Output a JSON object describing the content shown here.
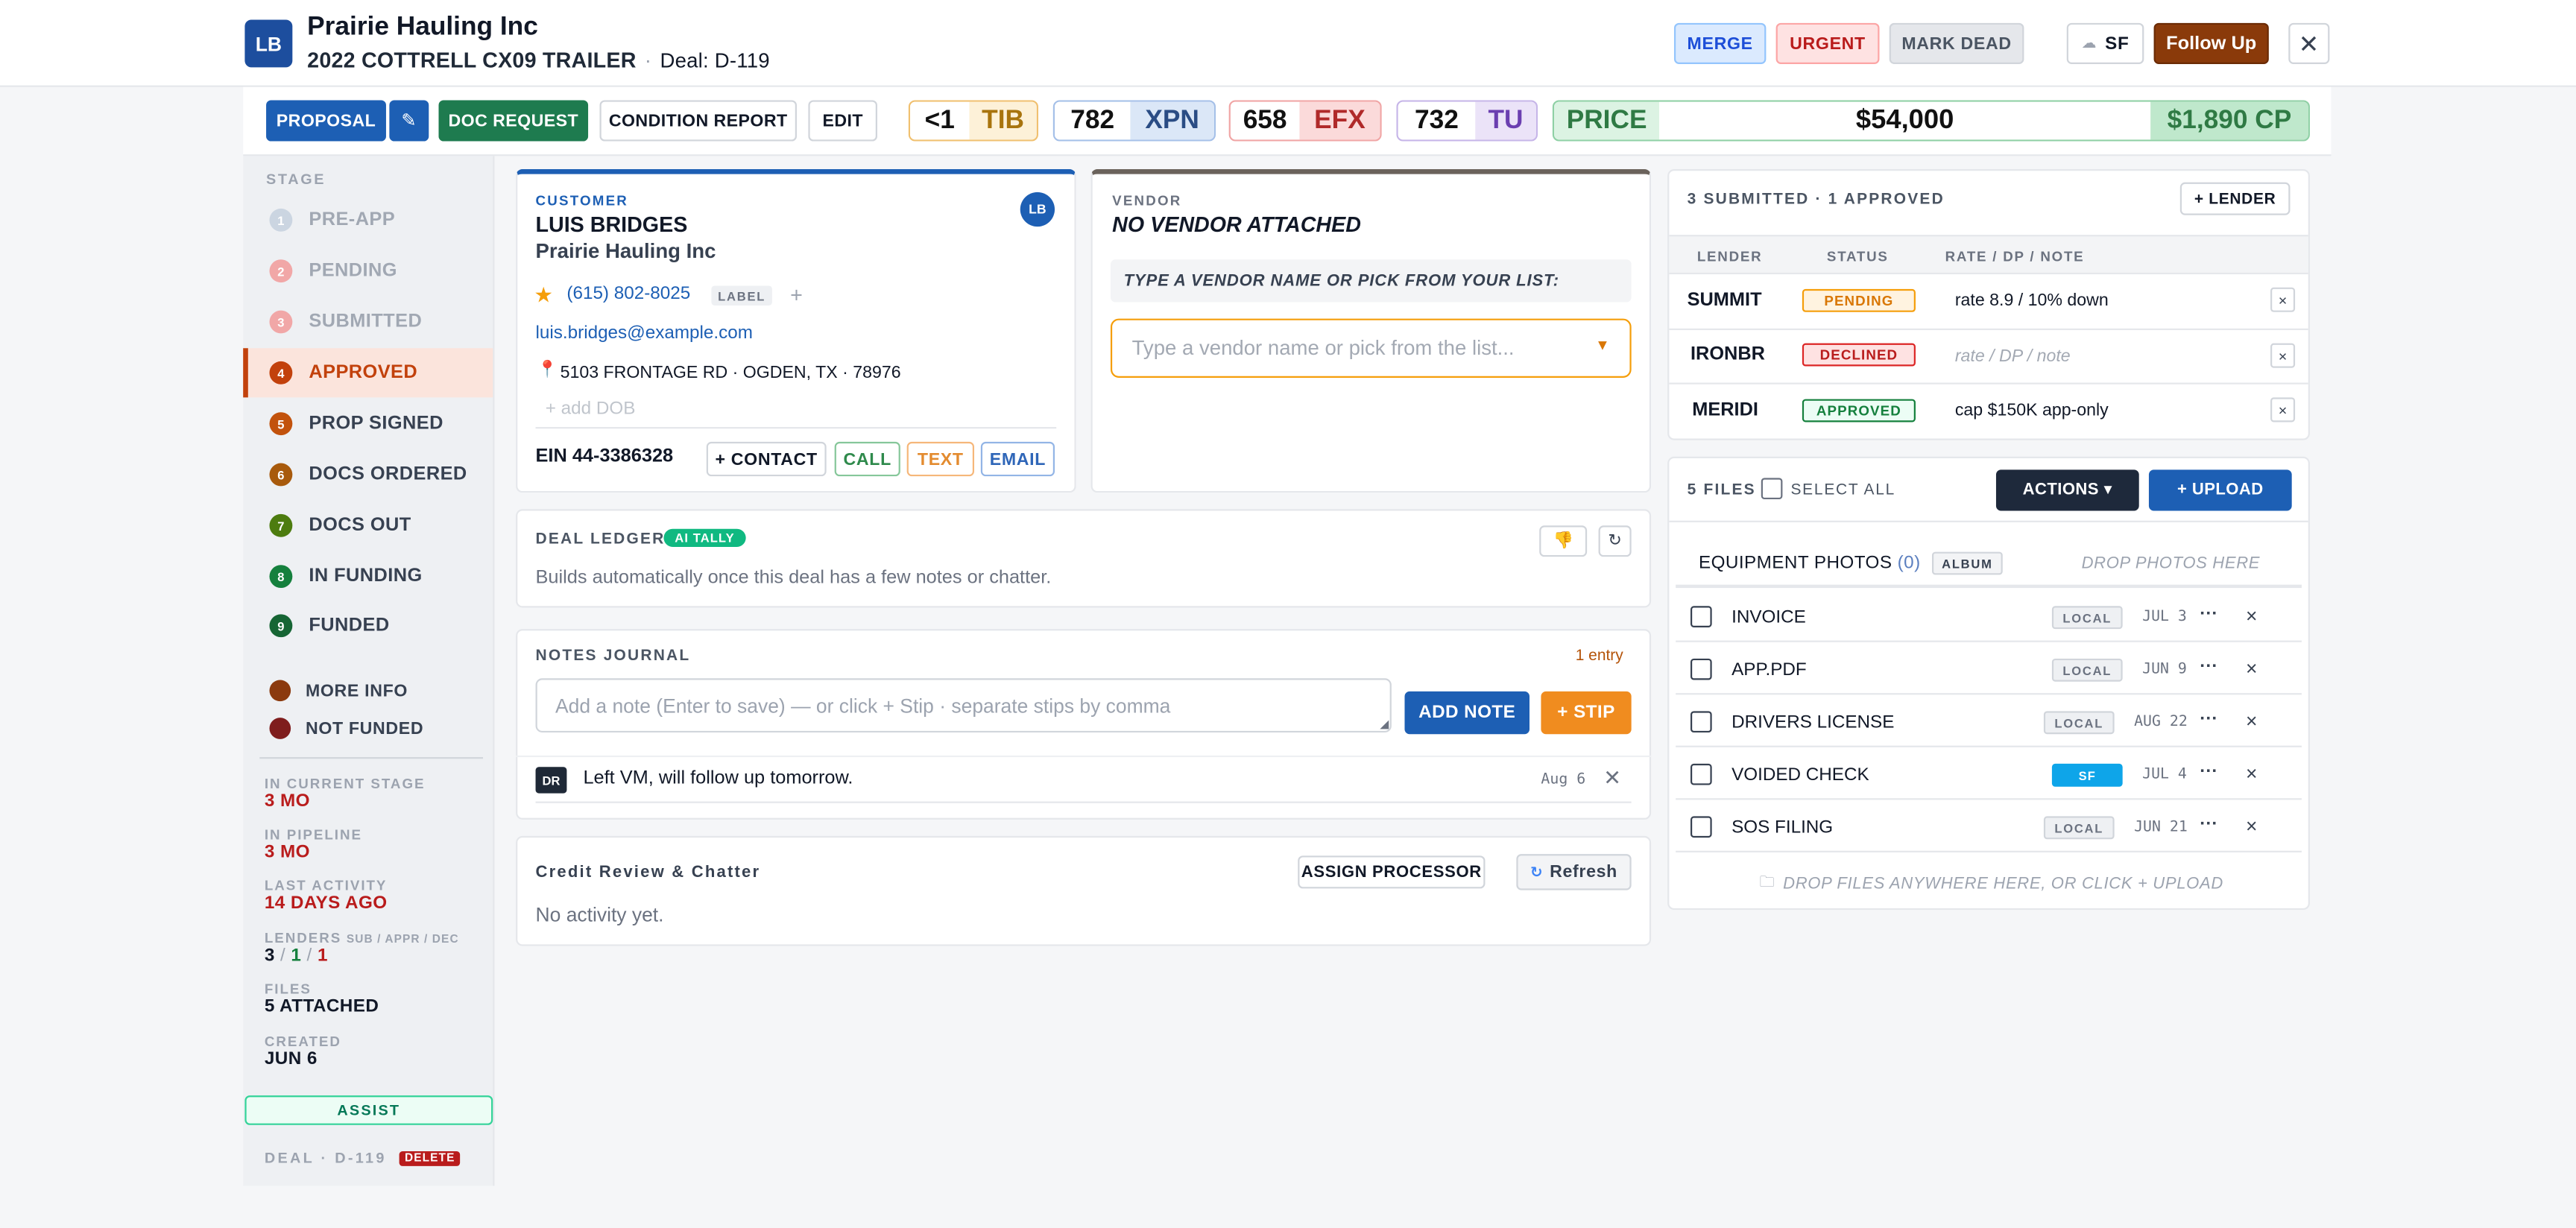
{
  "header": {
    "avatar": "LB",
    "company": "Prairie Hauling Inc",
    "equipment": "2022 COTTRELL CX09 TRAILER",
    "separator": "·",
    "deal": "Deal: D-119",
    "merge": "MERGE",
    "urgent": "URGENT",
    "mark_dead": "MARK DEAD",
    "sf": "SF",
    "follow_up": "Follow Up",
    "close": "✕"
  },
  "toolbar": {
    "proposal": "PROPOSAL",
    "edit_icon": "✎",
    "doc_request": "DOC REQUEST",
    "condition_report": "CONDITION REPORT",
    "edit": "EDIT"
  },
  "scores": {
    "tib_value": "<1",
    "tib_label": "TIB",
    "xpn_value": "782",
    "xpn_label": "XPN",
    "efx_value": "658",
    "efx_label": "EFX",
    "tu_value": "732",
    "tu_label": "TU",
    "price_label": "PRICE",
    "price_value": "$54,000",
    "cp_value": "$1,890 CP"
  },
  "sidebar": {
    "stage_header": "STAGE",
    "stages": [
      {
        "num": "1",
        "label": "PRE-APP"
      },
      {
        "num": "2",
        "label": "PENDING"
      },
      {
        "num": "3",
        "label": "SUBMITTED"
      },
      {
        "num": "4",
        "label": "APPROVED"
      },
      {
        "num": "5",
        "label": "PROP SIGNED"
      },
      {
        "num": "6",
        "label": "DOCS ORDERED"
      },
      {
        "num": "7",
        "label": "DOCS OUT"
      },
      {
        "num": "8",
        "label": "IN FUNDING"
      },
      {
        "num": "9",
        "label": "FUNDED"
      }
    ],
    "more_info": "MORE INFO",
    "not_funded": "NOT FUNDED",
    "in_current_stage_label": "IN CURRENT STAGE",
    "in_current_stage": "3 MO",
    "in_pipeline_label": "IN PIPELINE",
    "in_pipeline": "3 MO",
    "last_activity_label": "LAST ACTIVITY",
    "last_activity": "14 DAYS AGO",
    "lenders_label": "LENDERS",
    "lenders_sub": "SUB / APPR / DEC",
    "lenders_sub_count": "3",
    "lenders_appr_count": "1",
    "lenders_dec_count": "1",
    "slash": "/",
    "files_label": "FILES",
    "files_value": "5 ATTACHED",
    "created_label": "CREATED",
    "created_value": "JUN 6",
    "assist": "ASSIST",
    "deal_footer": "DEAL · D-119",
    "delete": "DELETE"
  },
  "customer": {
    "section_label": "CUSTOMER",
    "name": "LUIS BRIDGES",
    "company": "Prairie Hauling Inc",
    "avatar": "LB",
    "phone": "(615) 802-8025",
    "label_tag": "LABEL",
    "plus": "+",
    "email": "luis.bridges@example.com",
    "address": "5103 FRONTAGE RD · OGDEN, TX · 78976",
    "add_dob": "+ add DOB",
    "ein": "EIN 44-3386328",
    "add_contact": "+ CONTACT",
    "call": "CALL",
    "text": "TEXT",
    "email_btn": "EMAIL"
  },
  "vendor": {
    "section_label": "VENDOR",
    "none": "NO VENDOR ATTACHED",
    "hint": "TYPE A VENDOR NAME OR PICK FROM YOUR LIST:",
    "placeholder": "Type a vendor name or pick from the list..."
  },
  "ledger": {
    "title": "DEAL LEDGER",
    "badge": "AI TALLY",
    "text": "Builds automatically once this deal has a few notes or chatter.",
    "refresh_icon": "↻"
  },
  "notes": {
    "title": "NOTES JOURNAL",
    "count": "1 entry",
    "placeholder": "Add a note (Enter to save) — or click + Stip · separate stips by comma",
    "add_note": "ADD NOTE",
    "stip": "+ STIP",
    "entry_initials": "DR",
    "entry_text": "Left VM, will follow up tomorrow.",
    "entry_date": "Aug 6",
    "entry_delete": "✕"
  },
  "credit": {
    "title": "Credit Review & Chatter",
    "assign": "ASSIGN PROCESSOR",
    "refresh": "Refresh",
    "empty": "No activity yet."
  },
  "lenders": {
    "summary": "3 SUBMITTED · 1 APPROVED",
    "add": "+ LENDER",
    "headers": [
      "LENDER",
      "STATUS",
      "RATE / DP / NOTE"
    ],
    "rows": [
      {
        "name": "SUMMIT",
        "status": "PENDING",
        "note": "rate 8.9 / 10% down",
        "placeholder": false
      },
      {
        "name": "IRONBR",
        "status": "DECLINED",
        "note": "rate / DP / note",
        "placeholder": true
      },
      {
        "name": "MERIDI",
        "status": "APPROVED",
        "note": "cap $150K app-only",
        "placeholder": false
      }
    ],
    "remove": "×"
  },
  "files": {
    "count": "5 FILES",
    "select_all": "SELECT ALL",
    "actions": "ACTIONS ▾",
    "upload": "+ UPLOAD",
    "photos_label": "EQUIPMENT PHOTOS",
    "photos_count": "(0)",
    "album": "ALBUM",
    "drop_photos": "DROP PHOTOS HERE",
    "rows": [
      {
        "name": "INVOICE",
        "source": "LOCAL",
        "date": "JUL 3"
      },
      {
        "name": "APP.PDF",
        "source": "LOCAL",
        "date": "JUN 9"
      },
      {
        "name": "DRIVERS LICENSE",
        "source": "LOCAL",
        "date": "AUG 22"
      },
      {
        "name": "VOIDED CHECK",
        "source": "SF",
        "date": "JUL 4"
      },
      {
        "name": "SOS FILING",
        "source": "LOCAL",
        "date": "JUN 21"
      }
    ],
    "more": "···",
    "remove": "×",
    "drop_files": "DROP FILES ANYWHERE HERE, OR CLICK + UPLOAD"
  },
  "colors": {
    "primary": "#1d5fb4",
    "success": "#1e7b4f",
    "follow_up": "#8a3a0a",
    "approved_stage": "#c2410c",
    "stip": "#f08c1f"
  },
  "icons": [
    "star-icon",
    "map-pin-icon",
    "thumbs-down-icon",
    "refresh-icon",
    "cloud-icon",
    "close-icon",
    "chevron-down-icon",
    "folder-icon"
  ]
}
